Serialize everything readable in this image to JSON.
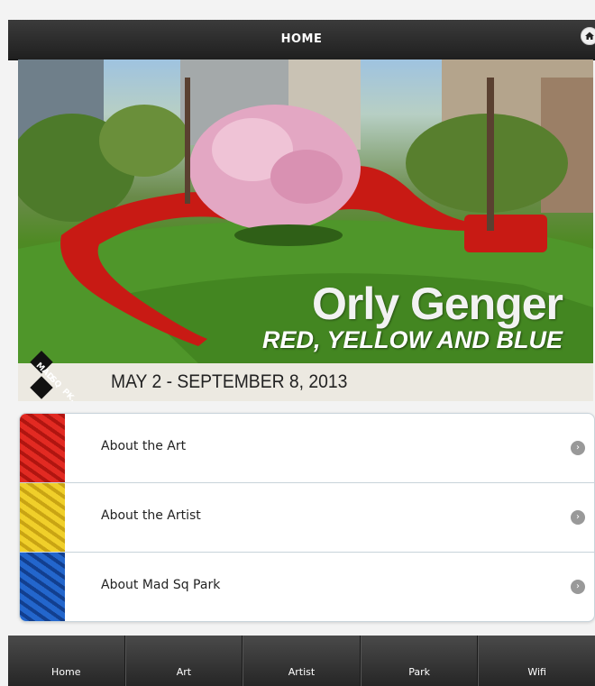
{
  "header": {
    "title": "HOME",
    "home_icon": "home-icon"
  },
  "hero": {
    "title": "Orly Genger",
    "subtitle": "RED, YELLOW AND BLUE",
    "colors": {
      "sky": "#9fc3e0",
      "grass": "#4f8a24",
      "sculpture": "#c81a14",
      "blossom": "#e3a7c3"
    }
  },
  "banner": {
    "date": "MAY 2 - SEPTEMBER 8, 2013",
    "logo_text": [
      "MAD",
      "SQ",
      "PK."
    ]
  },
  "list": {
    "items": [
      {
        "label": "About the Art",
        "thumb_color": "#d8201b",
        "icon": "chevron-right-icon"
      },
      {
        "label": "About the Artist",
        "thumb_color": "#e3c21c",
        "icon": "chevron-right-icon"
      },
      {
        "label": "About Mad Sq Park",
        "thumb_color": "#1c55b8",
        "icon": "chevron-right-icon"
      }
    ]
  },
  "tabbar": {
    "tabs": [
      {
        "label": "Home"
      },
      {
        "label": "Art"
      },
      {
        "label": "Artist"
      },
      {
        "label": "Park"
      },
      {
        "label": "Wifi"
      }
    ]
  }
}
